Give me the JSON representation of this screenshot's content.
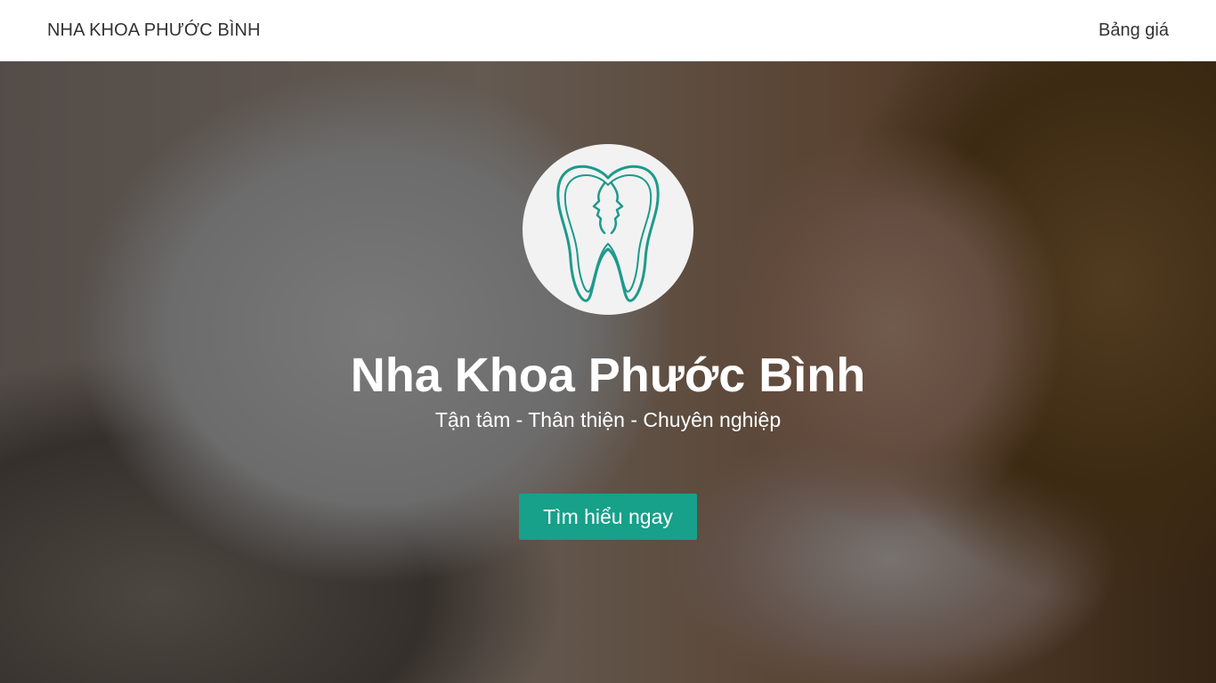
{
  "navbar": {
    "brand": "NHA KHOA PHƯỚC BÌNH",
    "link_price": "Bảng giá"
  },
  "hero": {
    "title": "Nha Khoa Phước Bình",
    "subtitle": "Tận tâm - Thân thiện - Chuyên nghiệp",
    "cta_label": "Tìm hiểu ngay",
    "logo_icon": "tooth-faces-icon"
  },
  "colors": {
    "accent": "#17a08a",
    "logo_stroke": "#1d9a8c",
    "navbar_bg": "#ffffff",
    "text_dark": "#333333"
  }
}
